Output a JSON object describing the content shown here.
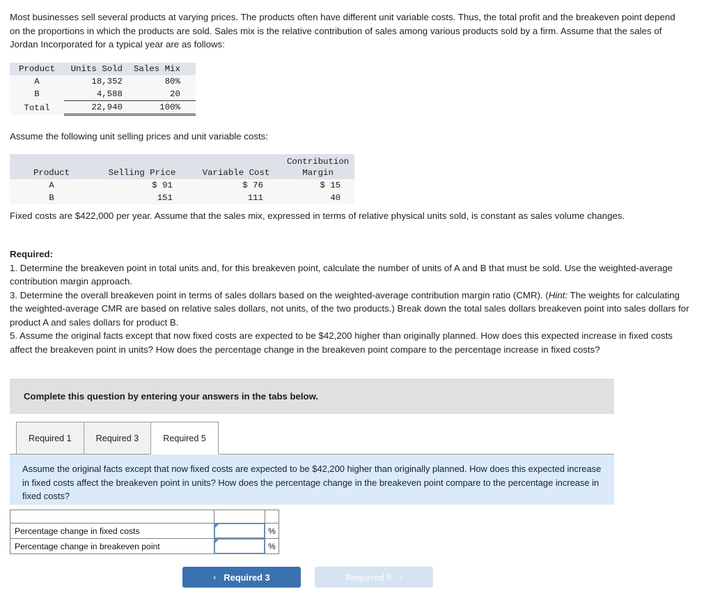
{
  "intro": {
    "paragraph": "Most businesses sell several products at varying prices. The products often have different unit variable costs. Thus, the total profit and the breakeven point depend on the proportions in which the products are sold. Sales mix is the relative contribution of sales among various products sold by a firm. Assume that the sales of Jordan Incorporated for a typical year are as follows:"
  },
  "sales_mix_table": {
    "headers": [
      "Product",
      "Units Sold",
      "Sales Mix"
    ],
    "rows": [
      {
        "product": "A",
        "units_sold": "18,352",
        "sales_mix": "80%"
      },
      {
        "product": "B",
        "units_sold": "4,588",
        "sales_mix": "20"
      }
    ],
    "total": {
      "product": "Total",
      "units_sold": "22,940",
      "sales_mix": "100%"
    }
  },
  "assume_line": "Assume the following unit selling prices and unit variable costs:",
  "price_cost_table": {
    "headers": [
      "Product",
      "Selling Price",
      "Variable Cost",
      "Contribution Margin"
    ],
    "header_cm_line1": "Contribution",
    "header_cm_line2": "Margin",
    "rows": [
      {
        "product": "A",
        "selling_price": "$ 91",
        "variable_cost": "$ 76",
        "contribution_margin": "$ 15"
      },
      {
        "product": "B",
        "selling_price": "151",
        "variable_cost": "111",
        "contribution_margin": "40"
      }
    ]
  },
  "fixed_costs_paragraph": "Fixed costs are $422,000 per year. Assume that the sales mix, expressed in terms of relative physical units sold, is constant as sales volume changes.",
  "required": {
    "heading": "Required:",
    "item1": "1. Determine the breakeven point in total units and, for this breakeven point, calculate the number of units of A and B that must be sold. Use the weighted-average contribution margin approach.",
    "item3_part1": "3. Determine the overall breakeven point in terms of sales dollars based on the weighted-average contribution margin ratio (CMR). (",
    "item3_hint_label": "Hint:",
    "item3_part2": " The weights for calculating the weighted-average CMR are based on relative sales dollars, not units, of the two products.) Break down the total sales dollars breakeven point into sales dollars for product A and sales dollars for product B.",
    "item5": "5. Assume the original facts except that now fixed costs are expected to be $42,200 higher than originally planned. How does this expected increase in fixed costs affect the breakeven point in units? How does the percentage change in the breakeven point compare to the percentage increase in fixed costs?"
  },
  "complete_banner": "Complete this question by entering your answers in the tabs below.",
  "tabs": [
    {
      "label": "Required 1",
      "active": false
    },
    {
      "label": "Required 3",
      "active": false
    },
    {
      "label": "Required 5",
      "active": true
    }
  ],
  "question_panel": {
    "text": "Assume the original facts except that now fixed costs are expected to be $42,200 higher than originally planned. How does this expected increase in fixed costs affect the breakeven point in units? How does the percentage change in the breakeven point compare to the percentage increase in fixed costs?"
  },
  "answer_table": {
    "rows": [
      {
        "label": "Percentage change in fixed costs",
        "value": "",
        "unit": "%"
      },
      {
        "label": "Percentage change in breakeven point",
        "value": "",
        "unit": "%"
      }
    ]
  },
  "nav": {
    "prev_label": "Required 3",
    "prev_chevron": "‹",
    "next_label": "Required 5",
    "next_chevron": "›"
  },
  "colors": {
    "header_blue": "#73a8db",
    "panel_blue": "#daeaf8",
    "banner_gray": "#e0e0e0",
    "primary_button": "#3a72b0",
    "disabled_button": "#d7e3f0"
  }
}
